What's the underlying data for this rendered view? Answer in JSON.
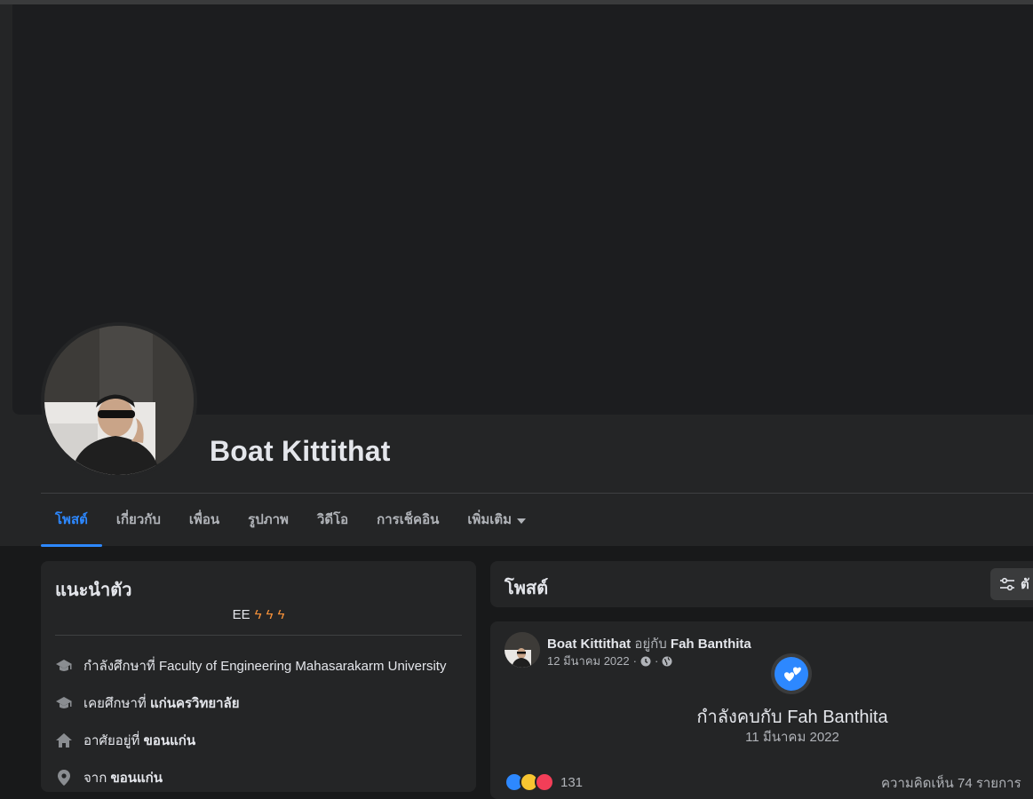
{
  "profile": {
    "name": "Boat Kittithat"
  },
  "tabs": [
    {
      "label": "โพสต์",
      "active": true
    },
    {
      "label": "เกี่ยวกับ"
    },
    {
      "label": "เพื่อน"
    },
    {
      "label": "รูปภาพ"
    },
    {
      "label": "วิดีโอ"
    },
    {
      "label": "การเช็คอิน"
    },
    {
      "label": "เพิ่มเติม",
      "has_caret": true
    }
  ],
  "intro": {
    "title": "แนะนำตัว",
    "bio_text": "EE",
    "bio_icons": [
      "lightning-emoji",
      "lightning-emoji",
      "lightning-emoji"
    ],
    "items": [
      {
        "icon": "graduation-cap-icon",
        "prefix": "กำลังศึกษาที่ ",
        "value": "Faculty of Engineering Mahasarakarm University"
      },
      {
        "icon": "graduation-cap-icon",
        "prefix": "เคยศึกษาที่ ",
        "value": "แก่นครวิทยาลัย"
      },
      {
        "icon": "home-icon",
        "prefix": "อาศัยอยู่ที่ ",
        "value": "ขอนแก่น"
      },
      {
        "icon": "location-pin-icon",
        "prefix": "จาก ",
        "value": "ขอนแก่น"
      }
    ]
  },
  "posts_section": {
    "title": "โพสต์",
    "filter_label": "ตั"
  },
  "post": {
    "author": "Boat Kittithat",
    "with_text": "อยู่กับ",
    "tagged": "Fah Banthita",
    "date": "12 มีนาคม 2022",
    "privacy_icon": "globe-icon",
    "event_title": "กำลังคบกับ Fah Banthita",
    "event_date": "11 มีนาคม 2022",
    "reaction_count": "131",
    "comment_count": "ความคิดเห็น 74 รายการ"
  },
  "colors": {
    "accent": "#2d88ff",
    "bolt": "#f7923a"
  }
}
